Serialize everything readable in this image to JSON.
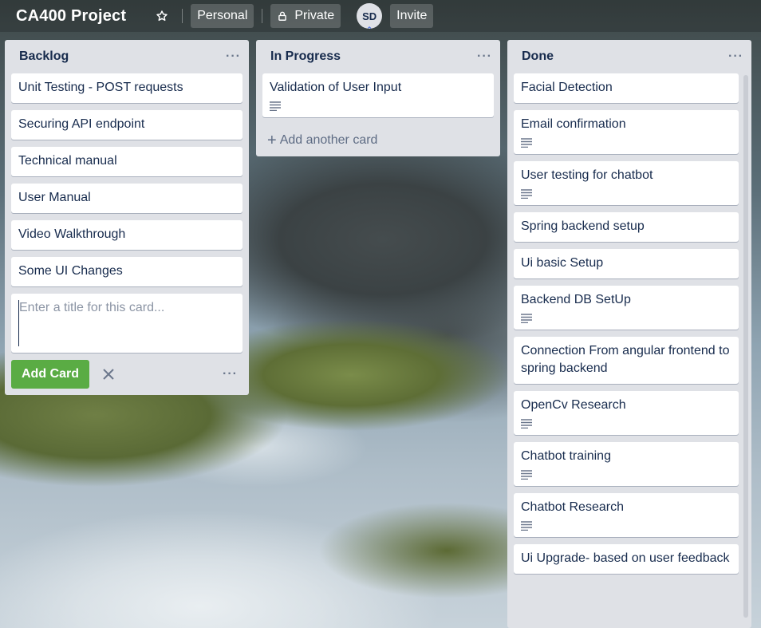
{
  "header": {
    "board_title": "CA400 Project",
    "team_label": "Personal",
    "visibility_label": "Private",
    "member_initials": "SD",
    "invite_label": "Invite"
  },
  "lists": [
    {
      "title": "Backlog",
      "cards": [
        {
          "title": "Unit Testing - POST requests"
        },
        {
          "title": "Securing API endpoint"
        },
        {
          "title": "Technical manual"
        },
        {
          "title": "User Manual"
        },
        {
          "title": "Video Walkthrough"
        },
        {
          "title": "Some UI Changes"
        }
      ],
      "composer": {
        "placeholder": "Enter a title for this card...",
        "add_label": "Add Card"
      }
    },
    {
      "title": "In Progress",
      "cards": [
        {
          "title": "Validation of User Input",
          "has_description": true
        }
      ],
      "add_another_label": "Add another card"
    },
    {
      "title": "Done",
      "cards": [
        {
          "title": "Facial Detection"
        },
        {
          "title": "Email confirmation",
          "has_description": true
        },
        {
          "title": "User testing for chatbot",
          "has_description": true
        },
        {
          "title": "Spring backend setup"
        },
        {
          "title": "Ui basic Setup"
        },
        {
          "title": "Backend DB SetUp",
          "has_description": true
        },
        {
          "title": "Connection From angular frontend to spring backend"
        },
        {
          "title": "OpenCv Research",
          "has_description": true
        },
        {
          "title": "Chatbot training",
          "has_description": true
        },
        {
          "title": "Chatbot Research",
          "has_description": true
        },
        {
          "title": "Ui Upgrade- based on user feedback"
        }
      ]
    }
  ],
  "icons": {
    "star": "star-icon",
    "lock": "lock-icon",
    "description": "description-icon",
    "close": "close-icon",
    "more": "more-icon",
    "plus": "plus-icon"
  },
  "colors": {
    "list_bg": "#dfe1e6",
    "card_text": "#172b4d",
    "add_button": "#5aac44"
  }
}
